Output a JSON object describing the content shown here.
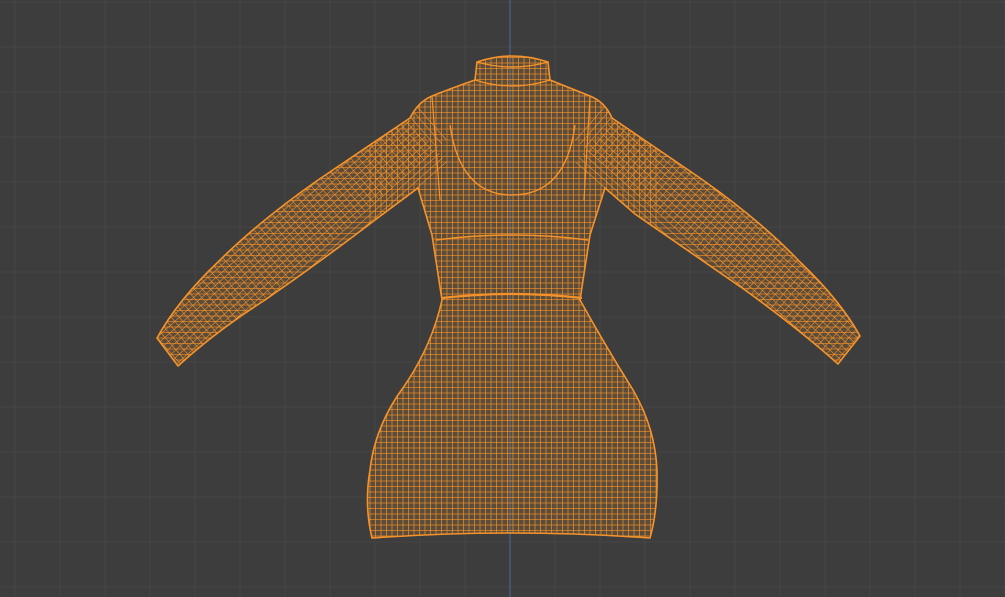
{
  "viewport": {
    "background_color": "#3d3d3d",
    "grid_minor_color": "#454545",
    "grid_major_color": "#4e4e4e",
    "axis_color": "#4a6b9a",
    "selection_color": "#f5932a",
    "selection_fill": "#e58a2a",
    "show_grid": true,
    "view_mode": "wireframe",
    "selected_object": {
      "icon": "mesh-object-icon",
      "type": "dress-mesh"
    }
  }
}
